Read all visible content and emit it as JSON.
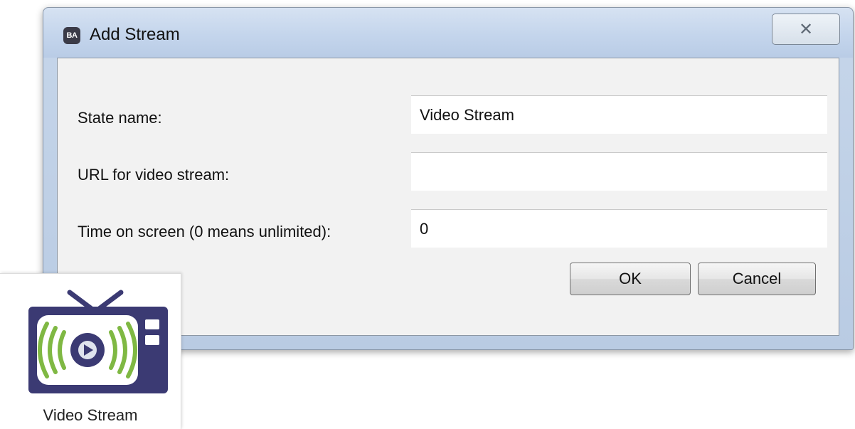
{
  "dialog": {
    "title": "Add Stream",
    "app_icon_text": "BA",
    "close_glyph": "✕",
    "fields": {
      "state_name": {
        "label": "State name:",
        "value": "Video Stream"
      },
      "url": {
        "label": "URL for video stream:",
        "value": ""
      },
      "time_on_screen": {
        "label": "Time on screen (0 means unlimited):",
        "value": "0"
      }
    },
    "buttons": {
      "ok": "OK",
      "cancel": "Cancel"
    }
  },
  "tile": {
    "label": "Video Stream",
    "icon": "tv-stream-icon",
    "colors": {
      "tv_body": "#3b3a73",
      "screen": "#ffffff",
      "waves": "#7fb843",
      "play": "#3b3a73"
    }
  }
}
